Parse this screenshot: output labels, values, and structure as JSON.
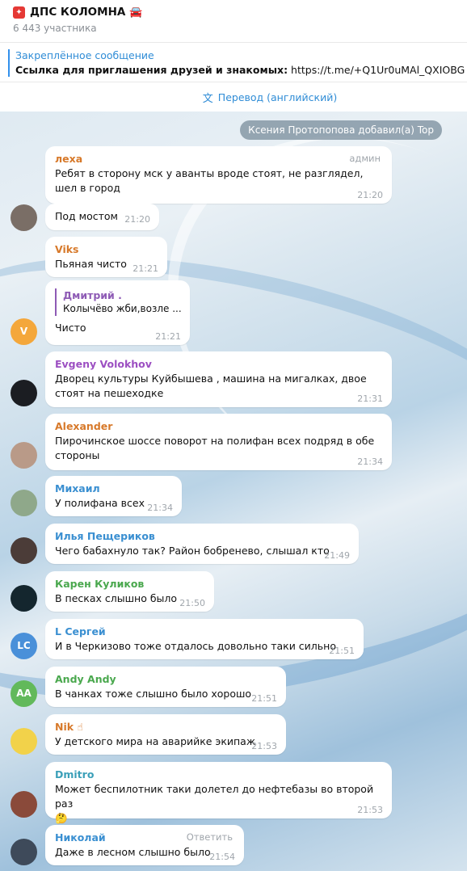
{
  "header": {
    "title": "ДПС КОЛОМНА",
    "subtitle": "6 443 участника",
    "icon_left": "sos-red-icon",
    "icon_right": "police-car-icon"
  },
  "pinned": {
    "title": "Закреплённое сообщение",
    "bold": "Ссылка для приглашения друзей и знакомых:",
    "link": " https://t.me/+Q1Ur0uMAl_QXIOBG"
  },
  "translate": {
    "label": "Перевод (английский)"
  },
  "service": "Ксения Протопопова добавил(а) Top",
  "messages": [
    {
      "name": "леха",
      "color": "#d7792a",
      "badge": "админ",
      "text": "Ребят в сторону мск у аванты вроде стоят, не разглядел, шел в город",
      "time": "21:20"
    },
    {
      "name": "",
      "text": "Под мостом",
      "time": "21:20"
    },
    {
      "name": "Viks",
      "color": "#d7792a",
      "text": "Пьяная чисто",
      "time": "21:21"
    },
    {
      "name": "",
      "reply_name": "Дмитрий .",
      "reply_text": "Колычёво жби,возле ...",
      "text": "Чисто",
      "time": "21:21",
      "avatar_letter": "V",
      "avatar_color": "#f4a73b"
    },
    {
      "name": "Evgeny Volokhov",
      "color": "#9c4fc2",
      "text": "Дворец культуры Куйбышева , машина на мигалках, двое стоят на пешеходке",
      "time": "21:31"
    },
    {
      "name": "Alexander",
      "color": "#d7792a",
      "text": "Пирочинское шоссе поворот на полифан всех подряд в обе стороны",
      "time": "21:34"
    },
    {
      "name": "Михаил",
      "color": "#3a8fd1",
      "text": "У полифана всех",
      "time": "21:34"
    },
    {
      "name": "Илья Пещериков",
      "color": "#3a8fd1",
      "text": "Чего бабахнуло так? Район бобренево, слышал кто",
      "time": "21:49"
    },
    {
      "name": "Карен Куликов",
      "color": "#4aa84e",
      "text": "В песках слышно было",
      "time": "21:50"
    },
    {
      "name": "L Сергей",
      "color": "#3a8fd1",
      "text": "И в Черкизово тоже отдалось довольно таки сильно",
      "time": "21:51",
      "avatar_letter": "LC",
      "avatar_color": "#4a90d9"
    },
    {
      "name": "Andy Andy",
      "color": "#4aa84e",
      "text": "В чанках тоже слышно было хорошо",
      "time": "21:51",
      "avatar_letter": "AA",
      "avatar_color": "#62b95b"
    },
    {
      "name": "Nik",
      "color": "#d7792a",
      "text": "У детского мира на аварийке экипаж",
      "time": "21:53"
    },
    {
      "name": "Dmitro",
      "color": "#3a9fb8",
      "text": "Может беспилотник таки долетел до нефтебазы во второй раз",
      "emoji": "🤔",
      "time": "21:53"
    },
    {
      "name": "Николай",
      "color": "#3a8fd1",
      "badge": "Ответить",
      "text": "Даже в лесном слышно было",
      "time": "21:54"
    }
  ],
  "colors": {
    "link": "#2f8cd6",
    "bubble": "#ffffff",
    "time": "#a0a6ac"
  }
}
